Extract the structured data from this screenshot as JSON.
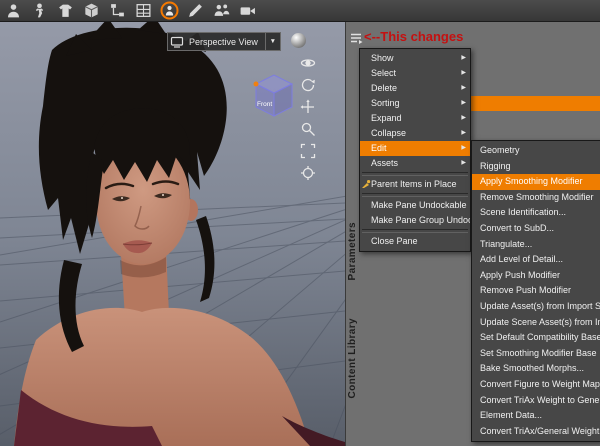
{
  "glyphs": {
    "submenu_arrow": "▶",
    "dropdown_arrow": "▼"
  },
  "colors": {
    "highlight_orange": "#ef7d00",
    "annotation_red": "#c41111",
    "menu_bg": "#474747"
  },
  "toolbar": {
    "icons": [
      "actor-icon",
      "pose-icon",
      "wardrobe-icon",
      "props-icon",
      "scene-list-icon",
      "surfaces-icon",
      "active-tool-icon",
      "paint-icon",
      "people-icon",
      "render-camera-icon"
    ]
  },
  "viewport": {
    "view_selector_label": "Perspective View",
    "gizmo_label": "Front"
  },
  "annotation": {
    "text": "<--This changes"
  },
  "panel_tabs": {
    "parameters": "Parameters",
    "content_library": "Content Library"
  },
  "context_menu": {
    "items": [
      "Show",
      "Select",
      "Delete",
      "Sorting",
      "Expand",
      "Collapse",
      "Edit",
      "Assets",
      "Parent Items in Place",
      "Make Pane Undockable",
      "Make Pane Group Undockable",
      "Close Pane"
    ]
  },
  "edit_submenu": {
    "items": [
      "Geometry",
      "Rigging",
      "Apply Smoothing Modifier",
      "Remove Smoothing Modifier",
      "Scene Identification...",
      "Convert to SubD...",
      "Triangulate...",
      "Add Level of Detail...",
      "Apply Push Modifier",
      "Remove Push Modifier",
      "Update Asset(s) from Import Source",
      "Update Scene Asset(s) from Import...",
      "Set Default Compatibility Bases...",
      "Set Smoothing Modifier Base",
      "Bake Smoothed Morphs...",
      "Convert Figure to Weight Mapping...",
      "Convert TriAx Weight to General...",
      "Element Data...",
      "Convert TriAx/General Weight to..."
    ]
  }
}
